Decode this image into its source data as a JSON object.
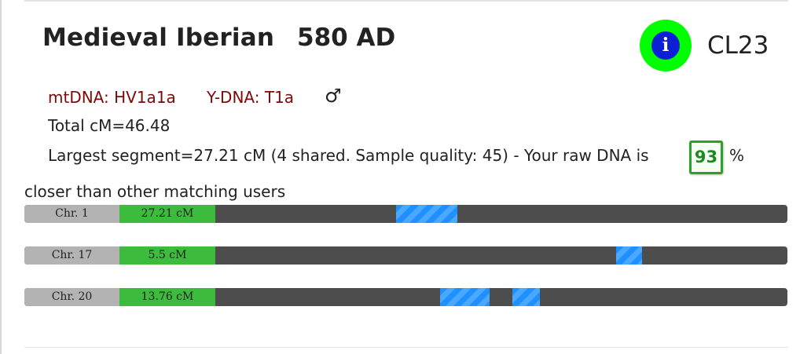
{
  "sample": {
    "title": "Medieval Iberian",
    "date": "580 AD",
    "code": "CL23",
    "info_icon_glyph": "i",
    "colors": {
      "info_badge_outer": "#00ff00",
      "info_badge_inner": "#0a1fd6",
      "haplogroup_text": "#7a0a0a"
    }
  },
  "haplogroups": {
    "mtdna": "mtDNA: HV1a1a",
    "ydna": "Y-DNA: T1a",
    "sex_icon": "♂"
  },
  "stats": {
    "total_cm": "Total cM=46.48",
    "largest_segment": "Largest segment=27.21 cM (4 shared. Sample quality: 45) - Your raw DNA is",
    "score": "93",
    "percent": "%",
    "closer_text": "closer than other matching users",
    "score_color": "#27a32a"
  },
  "chromosomes": [
    {
      "label": "Chr. 1",
      "cm": "27.21 cM",
      "segments": [
        {
          "start": 0.487,
          "end": 0.567
        }
      ]
    },
    {
      "label": "Chr. 17",
      "cm": "5.5 cM",
      "segments": [
        {
          "start": 0.776,
          "end": 0.81
        }
      ]
    },
    {
      "label": "Chr. 20",
      "cm": "13.76 cM",
      "segments": [
        {
          "start": 0.545,
          "end": 0.61
        },
        {
          "start": 0.64,
          "end": 0.676
        }
      ]
    }
  ],
  "segment_color": "#1e90ff"
}
